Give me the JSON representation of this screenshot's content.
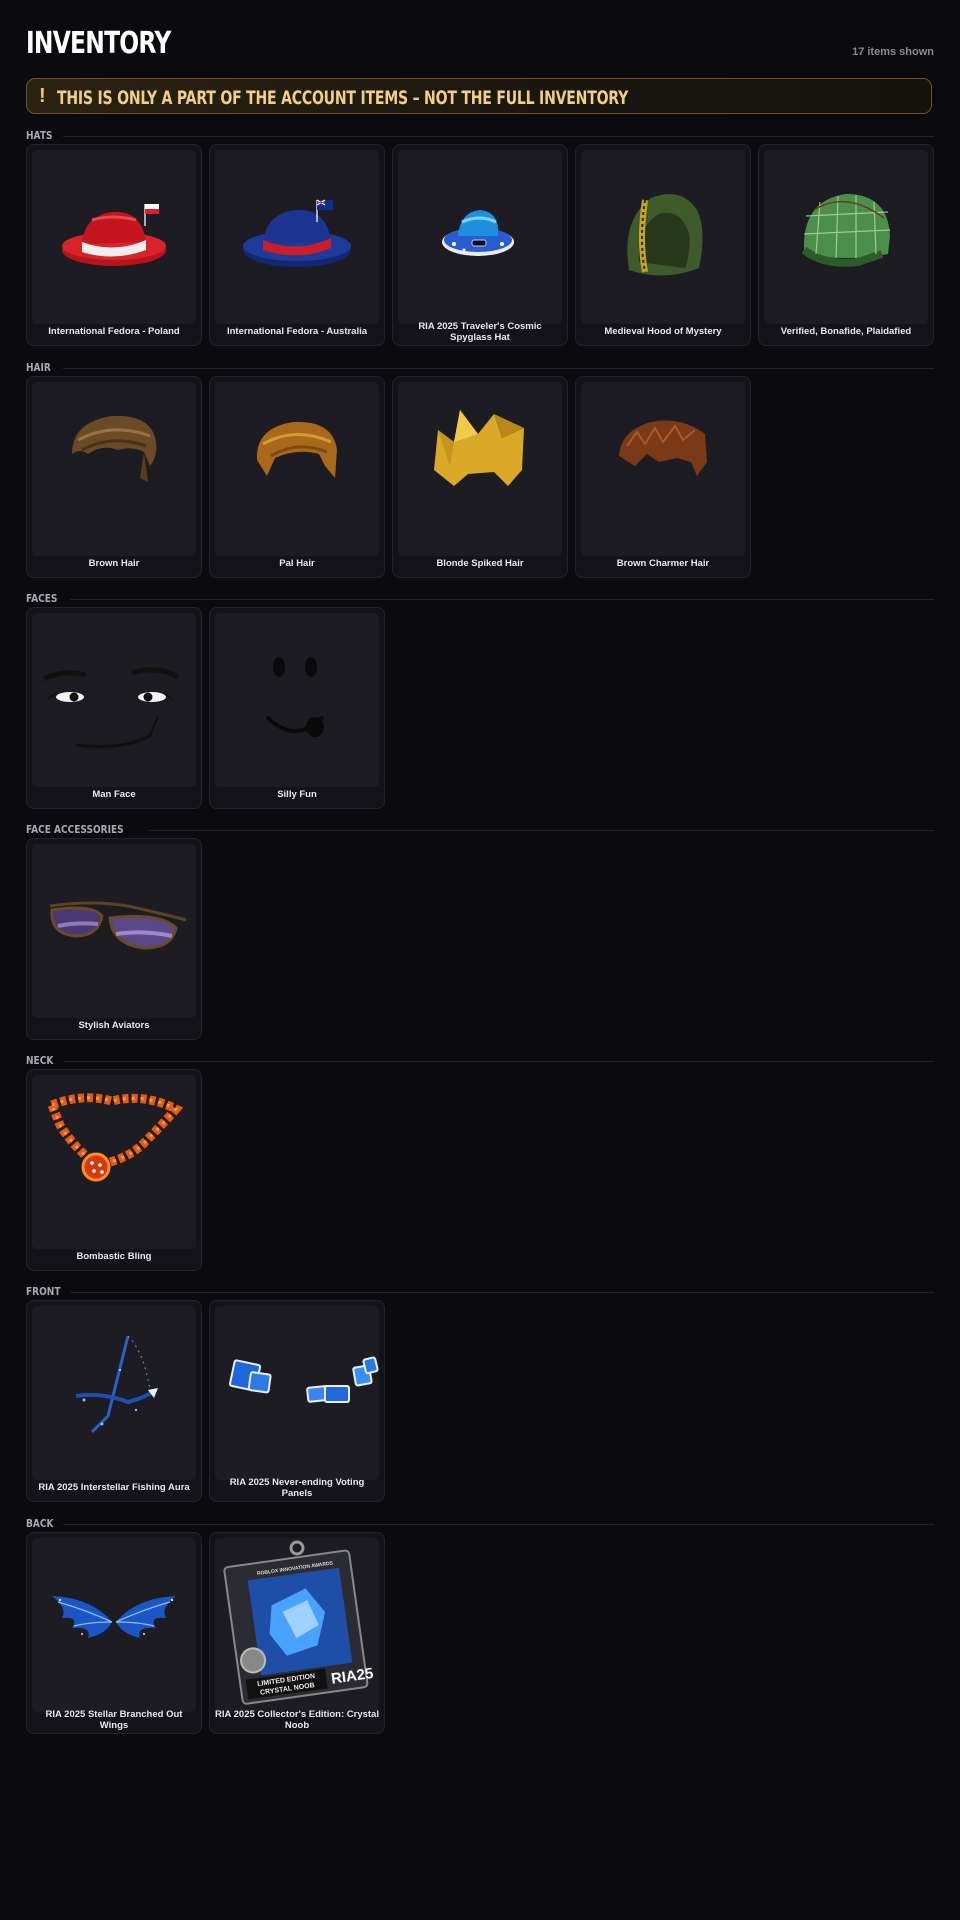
{
  "header": {
    "title": "INVENTORY",
    "count": "17 items shown"
  },
  "warning": {
    "icon": "exclamation-icon",
    "symbol": "!",
    "text": "THIS IS ONLY A PART OF THE ACCOUNT ITEMS – NOT THE FULL INVENTORY"
  },
  "colors": {
    "background": "#0a0a0f",
    "card": "#131319",
    "thumb": "#1c1c22",
    "warning_border": "#6b5527",
    "warning_text": "#f3cf86"
  },
  "sections": [
    {
      "label": "HATS",
      "items": [
        {
          "name": "International Fedora - Poland",
          "icon": "fedora-poland-icon"
        },
        {
          "name": "International Fedora - Australia",
          "icon": "fedora-australia-icon"
        },
        {
          "name": "RIA 2025 Traveler's Cosmic Spyglass Hat",
          "icon": "cosmic-hat-icon"
        },
        {
          "name": "Medieval Hood of Mystery",
          "icon": "hood-icon"
        },
        {
          "name": "Verified, Bonafide, Plaidafied",
          "icon": "plaid-cap-icon"
        }
      ]
    },
    {
      "label": "HAIR",
      "items": [
        {
          "name": "Brown Hair",
          "icon": "brown-hair-icon"
        },
        {
          "name": "Pal Hair",
          "icon": "pal-hair-icon"
        },
        {
          "name": "Blonde Spiked Hair",
          "icon": "blonde-hair-icon"
        },
        {
          "name": "Brown Charmer Hair",
          "icon": "charmer-hair-icon"
        }
      ]
    },
    {
      "label": "FACES",
      "items": [
        {
          "name": "Man Face",
          "icon": "man-face-icon"
        },
        {
          "name": "Silly Fun",
          "icon": "silly-fun-icon"
        }
      ]
    },
    {
      "label": "FACE ACCESSORIES",
      "items": [
        {
          "name": "Stylish Aviators",
          "icon": "aviators-icon"
        }
      ]
    },
    {
      "label": "NECK",
      "items": [
        {
          "name": "Bombastic Bling",
          "icon": "bling-chain-icon"
        }
      ]
    },
    {
      "label": "FRONT",
      "items": [
        {
          "name": "RIA 2025 Interstellar Fishing Aura",
          "icon": "fishing-aura-icon"
        },
        {
          "name": "RIA 2025 Never-ending Voting Panels",
          "icon": "voting-panels-icon"
        }
      ]
    },
    {
      "label": "BACK",
      "items": [
        {
          "name": "RIA 2025 Stellar Branched Out Wings",
          "icon": "wings-icon"
        },
        {
          "name": "RIA 2025 Collector's Edition: Crystal Noob",
          "icon": "crystal-noob-box-icon",
          "box_texts": [
            "ROBLOX INNOVATION AWARDS",
            "LIMITED EDITION",
            "CRYSTAL NOOB",
            "RIA25"
          ]
        }
      ]
    }
  ]
}
